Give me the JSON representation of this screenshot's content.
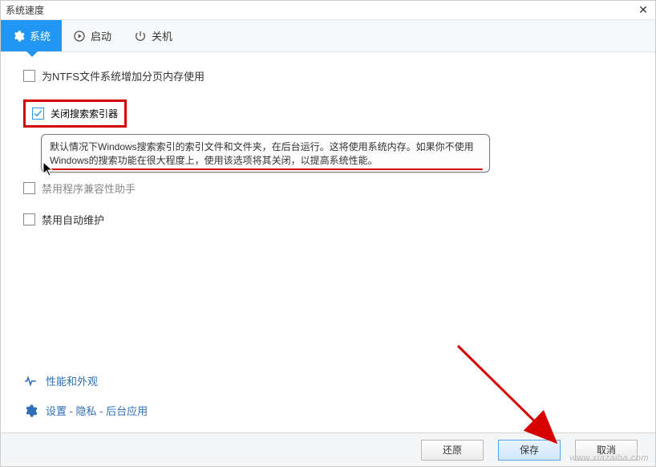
{
  "window": {
    "title": "系统速度",
    "close_glyph": "✕"
  },
  "tabs": {
    "system": "系统",
    "startup": "启动",
    "shutdown": "关机"
  },
  "options": {
    "opt1": "为NTFS文件系统增加分页内存使用",
    "opt2": "关闭搜索索引器",
    "opt3": "禁用程序兼容性助手",
    "opt4": "禁用自动维护"
  },
  "tooltip": {
    "text": "默认情况下Windows搜索索引的索引文件和文件夹，在后台运行。这将使用系统内存。如果你不使用Windows的搜索功能在很大程度上，使用该选项将其关闭，以提高系统性能。"
  },
  "links": {
    "perf": "性能和外观",
    "settings": "设置 - 隐私 - 后台应用"
  },
  "footer": {
    "restore": "还原",
    "save": "保存",
    "cancel": "取消"
  },
  "watermark": "www.xiazaiba.com"
}
